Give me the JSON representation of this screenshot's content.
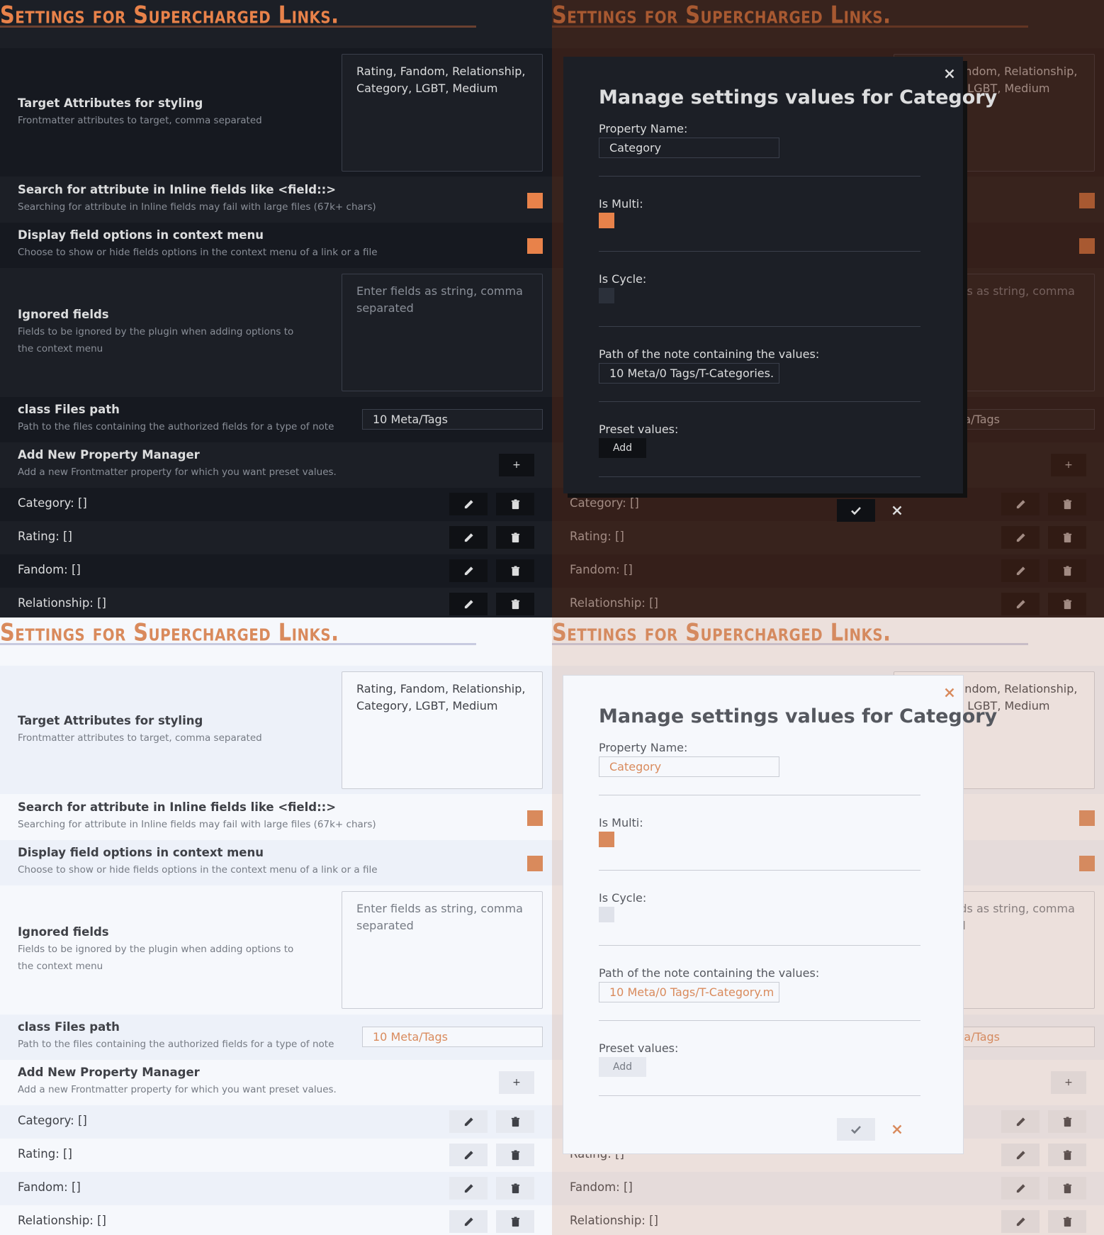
{
  "title": "Settings for Supercharged Links.",
  "settings": {
    "target_attributes": {
      "name": "Target Attributes for styling",
      "desc": "Frontmatter attributes to target, comma separated",
      "value": "Rating, Fandom, Relationship, Category, LGBT, Medium"
    },
    "inline_fields": {
      "name": "Search for attribute in Inline fields like <field::>",
      "desc": "Searching for attribute in Inline fields may fail with large files (67k+ chars)"
    },
    "context_menu": {
      "name": "Display field options in context menu",
      "desc": "Choose to show or hide fields options in the context menu of a link or a file"
    },
    "ignored_fields": {
      "name": "Ignored fields",
      "desc": "Fields to be ignored by the plugin when adding options to the context menu",
      "placeholder": "Enter fields as string, comma separated"
    },
    "class_files_path": {
      "name": "class Files path",
      "desc": "Path to the files containing the authorized fields for a type of note",
      "value": "10 Meta/Tags"
    },
    "add_manager": {
      "name": "Add New Property Manager",
      "desc": "Add a new Frontmatter property for which you want preset values.",
      "button": "+"
    },
    "properties": [
      "Category: []",
      "Rating: []",
      "Fandom: []",
      "Relationship: []"
    ]
  },
  "modal": {
    "title": "Manage settings values for Category",
    "property_name_label": "Property Name:",
    "property_name_value": "Category",
    "is_multi_label": "Is Multi:",
    "is_cycle_label": "Is Cycle:",
    "path_label": "Path of the note containing the values:",
    "path_value_dark": "10 Meta/0 Tags/T-Categories.",
    "path_value_light": "10 Meta/0 Tags/T-Category.m",
    "preset_label": "Preset values:",
    "add_button": "Add"
  },
  "themes": {
    "dark": {
      "bg": "#1c1f26",
      "band": "#161920",
      "text": "#dcddde",
      "muted": "#8a8f98",
      "accent": "#e8824a",
      "border": "#3a3f4b",
      "btn": "#0f1115"
    },
    "light": {
      "bg": "#f6f8fc",
      "band": "#edf1f9",
      "text": "#3f4147",
      "muted": "#767b84",
      "accent": "#d98a5c",
      "border": "#c9ccd4",
      "btn": "#e6e9f0"
    }
  }
}
